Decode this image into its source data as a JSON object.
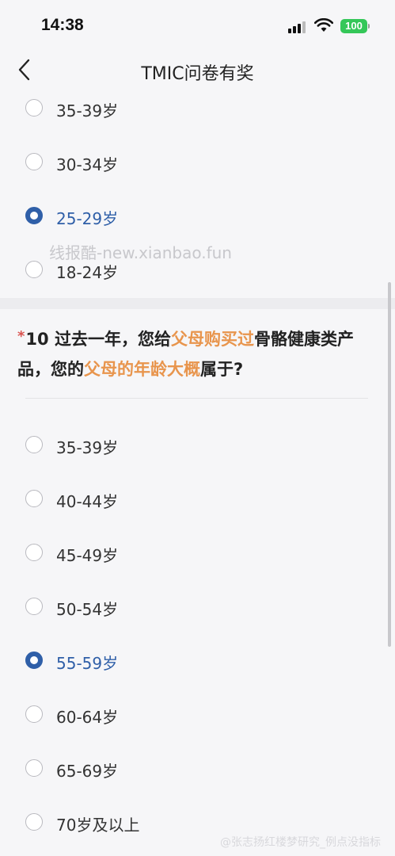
{
  "status_bar": {
    "time": "14:38",
    "battery": "100",
    "colors": {
      "battery": "#35c759"
    }
  },
  "nav": {
    "title": "TMIC问卷有奖",
    "back_icon": "chevron-left-icon"
  },
  "previous_question": {
    "options": [
      {
        "label": "35-39岁",
        "selected": false
      },
      {
        "label": "30-34岁",
        "selected": false
      },
      {
        "label": "25-29岁",
        "selected": true
      },
      {
        "label": "18-24岁",
        "selected": false
      }
    ]
  },
  "watermark": "线报酷-new.xianbao.fun",
  "question": {
    "required_mark": "*",
    "number": "10",
    "segments": [
      {
        "text": "过去一年，您给",
        "highlight": false
      },
      {
        "text": "父母购买过",
        "highlight": true
      },
      {
        "text": "骨骼健康类产品，您的",
        "highlight": false
      },
      {
        "text": "父母的年龄大概",
        "highlight": true
      },
      {
        "text": "属于?",
        "highlight": false
      }
    ],
    "colors": {
      "highlight": "#e8954d",
      "required": "#d9534f"
    },
    "options": [
      {
        "label": "35-39岁",
        "selected": false
      },
      {
        "label": "40-44岁",
        "selected": false
      },
      {
        "label": "45-49岁",
        "selected": false
      },
      {
        "label": "50-54岁",
        "selected": false
      },
      {
        "label": "55-59岁",
        "selected": true
      },
      {
        "label": "60-64岁",
        "selected": false
      },
      {
        "label": "65-69岁",
        "selected": false
      },
      {
        "label": "70岁及以上",
        "selected": false
      }
    ]
  },
  "footer_credit": "@张志扬红楼梦研究_例点没指标",
  "colors": {
    "selected": "#2f5fa8",
    "background": "#f6f6f8"
  }
}
